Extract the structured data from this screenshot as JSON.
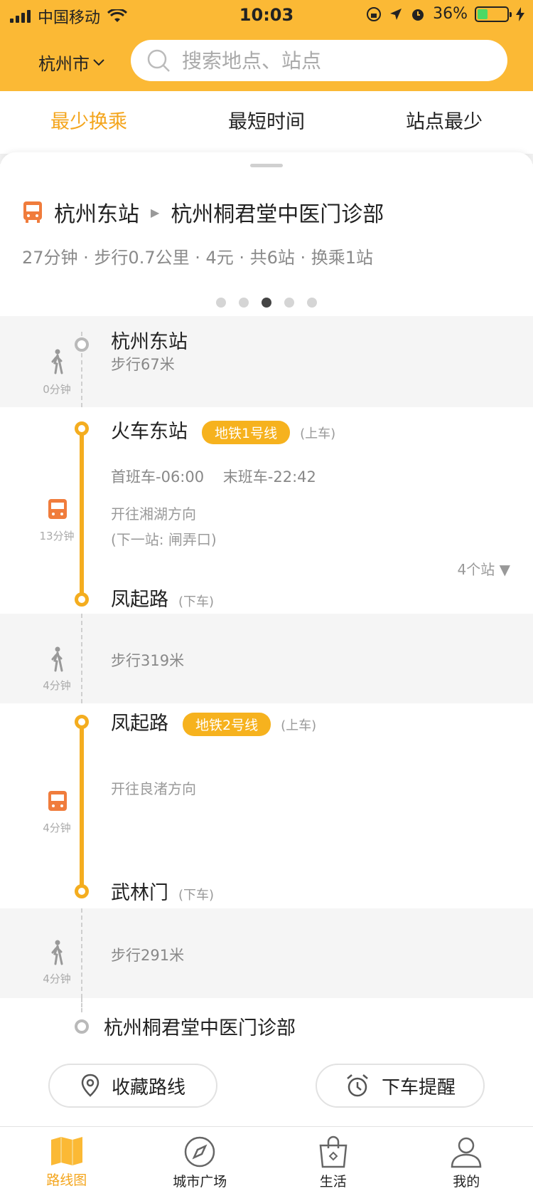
{
  "status_bar": {
    "carrier": "中国移动",
    "time": "10:03",
    "battery": "36%",
    "battery_level": 0.36
  },
  "header": {
    "city": "杭州市",
    "search_placeholder": "搜索地点、站点"
  },
  "tabs": [
    {
      "label": "最少换乘",
      "active": true
    },
    {
      "label": "最短时间",
      "active": false
    },
    {
      "label": "站点最少",
      "active": false
    }
  ],
  "route": {
    "from": "杭州东站",
    "to": "杭州桐君堂中医门诊部",
    "meta": "27分钟 · 步行0.7公里 · 4元 · 共6站 · 换乘1站",
    "page_count": 5,
    "active_page": 3
  },
  "segments": {
    "walk1": {
      "station": "杭州东站",
      "distance": "步行67米",
      "time": "0分钟"
    },
    "metro1": {
      "board": "火车东站",
      "line": "地铁1号线",
      "board_note": "(上车)",
      "schedule": "首班车-06:00    末班车-22:42",
      "direction": "开往湘湖方向",
      "next_stop": "(下一站: 闸弄口)",
      "time": "13分钟",
      "stops": "4个站 ▼",
      "alight": "凤起路",
      "alight_note": "(下车)"
    },
    "walk2": {
      "distance": "步行319米",
      "time": "4分钟"
    },
    "metro2": {
      "board": "凤起路",
      "line": "地铁2号线",
      "board_note": "(上车)",
      "direction": "开往良渚方向",
      "time": "4分钟",
      "alight": "武林门",
      "alight_note": "(下车)"
    },
    "walk3": {
      "distance": "步行291米",
      "time": "4分钟"
    },
    "destination": "杭州桐君堂中医门诊部"
  },
  "actions": {
    "save": "收藏路线",
    "remind": "下车提醒"
  },
  "bottom_nav": [
    {
      "label": "路线图",
      "icon": "map-icon",
      "active": true
    },
    {
      "label": "城市广场",
      "icon": "compass-icon",
      "active": false
    },
    {
      "label": "生活",
      "icon": "shopping-bag-icon",
      "active": false
    },
    {
      "label": "我的",
      "icon": "person-icon",
      "active": false
    }
  ],
  "colors": {
    "accent": "#fbb935",
    "line": "#f4ad1f",
    "active_tab": "#f4a51c",
    "bus_icon": "#f07c3c"
  }
}
